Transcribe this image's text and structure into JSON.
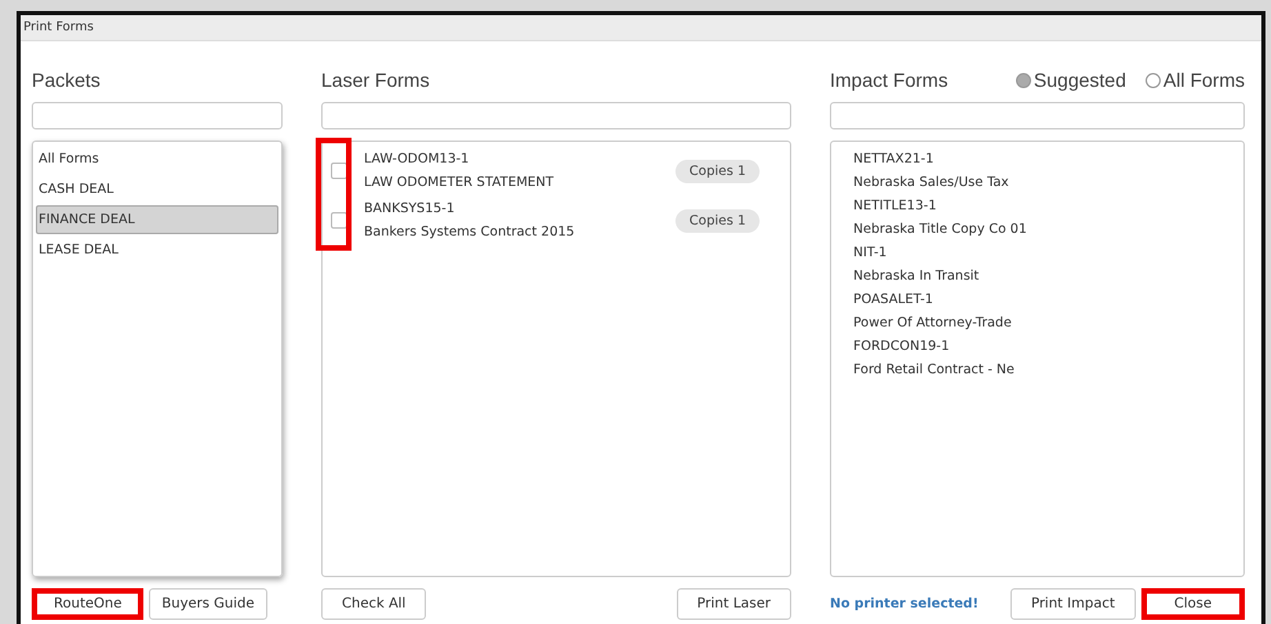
{
  "window": {
    "title": "Print Forms"
  },
  "packets": {
    "heading": "Packets",
    "items": [
      {
        "label": "All Forms",
        "selected": false
      },
      {
        "label": "CASH DEAL",
        "selected": false
      },
      {
        "label": "FINANCE DEAL",
        "selected": true
      },
      {
        "label": "LEASE DEAL",
        "selected": false
      }
    ],
    "buttons": [
      {
        "label": "RouteOne",
        "highlighted": true
      },
      {
        "label": "Buyers Guide",
        "highlighted": false
      }
    ]
  },
  "laser": {
    "heading": "Laser Forms",
    "checkboxes_highlighted": true,
    "items": [
      {
        "code": "LAW-ODOM13-1",
        "name": "LAW ODOMETER STATEMENT",
        "checked": false,
        "copies": "Copies 1"
      },
      {
        "code": "BANKSYS15-1",
        "name": "Bankers Systems Contract 2015",
        "checked": false,
        "copies": "Copies 1"
      }
    ],
    "buttons": [
      {
        "label": "Check All",
        "highlighted": false
      },
      {
        "label": "Print Laser",
        "highlighted": false
      }
    ]
  },
  "impact": {
    "heading": "Impact Forms",
    "radios": [
      {
        "label": "Suggested",
        "selected": true
      },
      {
        "label": "All Forms",
        "selected": false
      }
    ],
    "items": [
      {
        "code": "NETTAX21-1",
        "name": "Nebraska Sales/Use Tax"
      },
      {
        "code": "NETITLE13-1",
        "name": "Nebraska Title Copy Co 01"
      },
      {
        "code": "NIT-1",
        "name": "Nebraska In Transit"
      },
      {
        "code": "POASALET-1",
        "name": "Power Of Attorney-Trade"
      },
      {
        "code": "FORDCON19-1",
        "name": "Ford Retail Contract - Ne"
      }
    ],
    "status": "No printer selected!",
    "buttons": [
      {
        "label": "Print Impact",
        "highlighted": false
      },
      {
        "label": "Close",
        "highlighted": true
      }
    ]
  }
}
